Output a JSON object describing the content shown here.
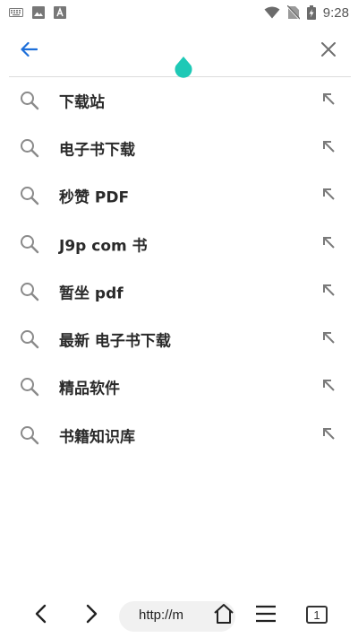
{
  "status_bar": {
    "time": "9:28",
    "icons": [
      "keyboard-icon",
      "image-icon",
      "font-icon",
      "wifi-icon",
      "no-sim-icon",
      "battery-charging-icon"
    ]
  },
  "search": {
    "value": "",
    "placeholder": "",
    "back_icon": "back-arrow-icon",
    "clear_icon": "close-icon"
  },
  "colors": {
    "accent": "#1e6fd9",
    "cursor_handle": "#1ec9b6",
    "icon_gray": "#8a8a8a"
  },
  "suggestions": [
    {
      "text": "下载站"
    },
    {
      "text": "电子书下载"
    },
    {
      "text": "秒赞 PDF"
    },
    {
      "text": "J9p com 书"
    },
    {
      "text": "暂坐 pdf"
    },
    {
      "text": "最新 电子书下载"
    },
    {
      "text": "精品软件"
    },
    {
      "text": "书籍知识库"
    }
  ],
  "toolbar": {
    "url_text": "http://m",
    "tab_count": "1",
    "icons": [
      "back-icon",
      "forward-icon",
      "home-icon",
      "menu-icon",
      "tabs-icon"
    ]
  }
}
